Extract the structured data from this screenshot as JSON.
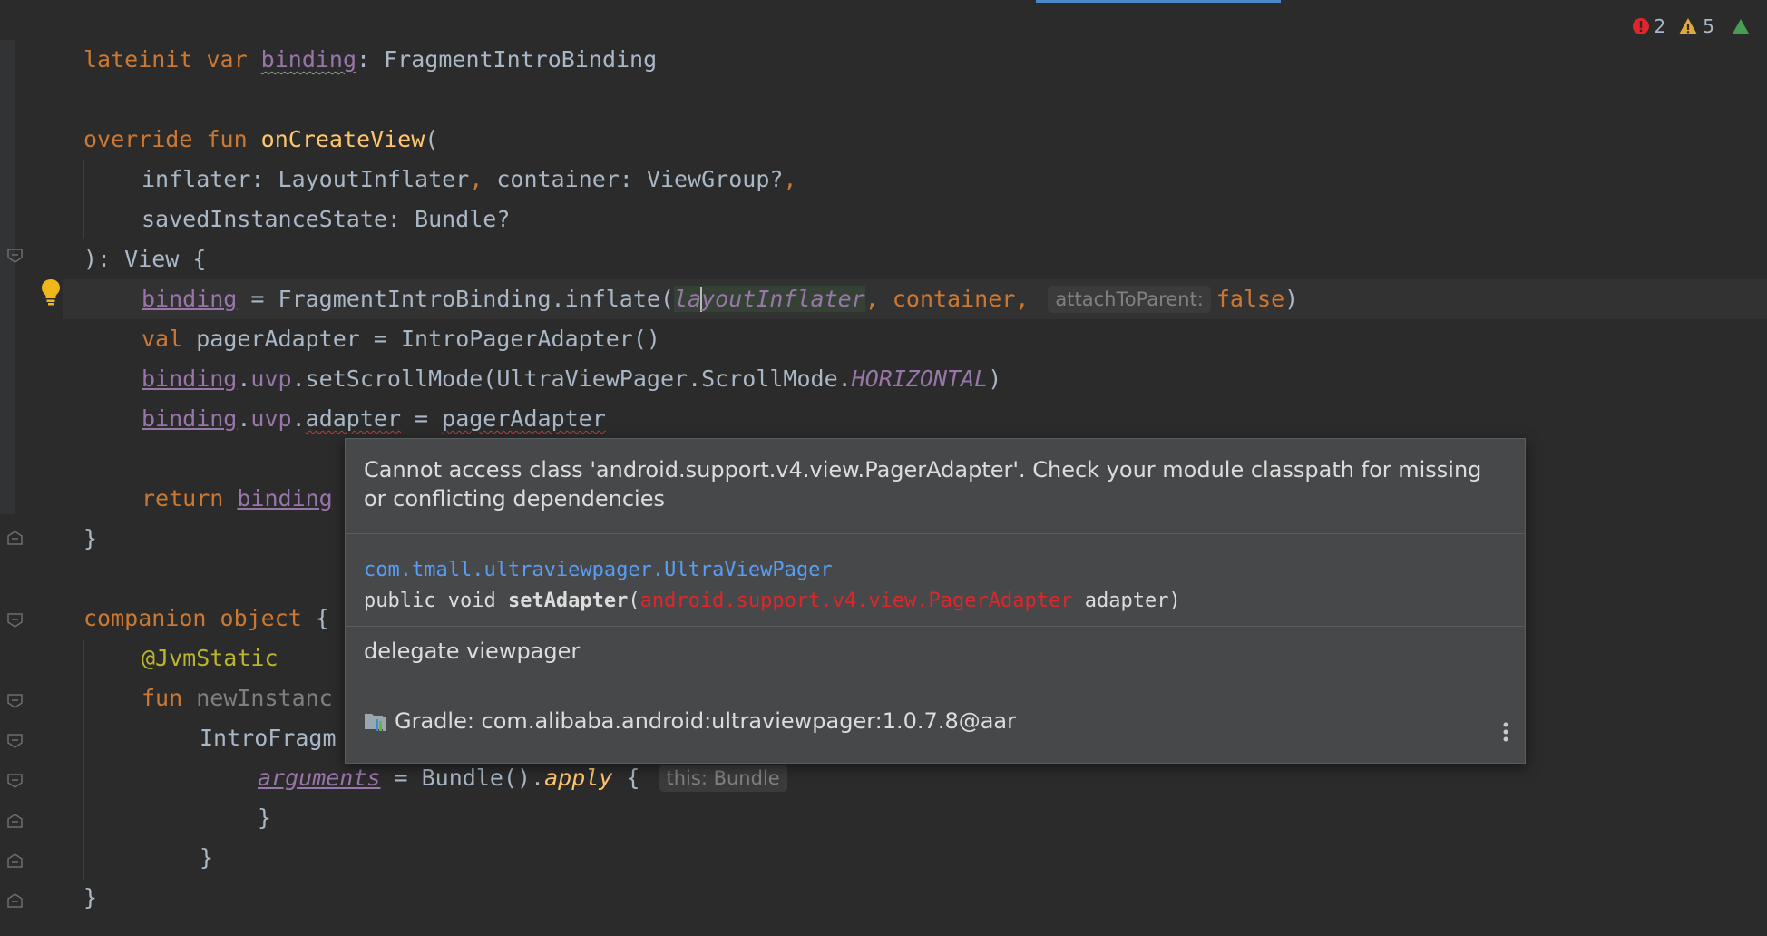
{
  "status": {
    "errors_count": "2",
    "warnings_count": "5"
  },
  "code": {
    "l1_kw": "lateinit var ",
    "l1_binding": "binding",
    "l1_rest": ": FragmentIntroBinding",
    "l2_override": "override fun ",
    "l2_fn": "onCreateView",
    "l2_paren": "(",
    "l3_a": "inflater: LayoutInflater",
    "l3_comma": ", ",
    "l3_b": "container: ViewGroup?",
    "l3_comma2": ",",
    "l4": "savedInstanceState: Bundle?",
    "l5": "): View {",
    "l6_binding": "binding",
    "l6_a": " = FragmentIntroBinding.inflate(",
    "l6_li_a": "la",
    "l6_li_b": "youtInflater",
    "l6_b": ", container, ",
    "l6_hint": "attachToParent:",
    "l6_false": "false",
    "l6_close": ")",
    "l7_val": "val ",
    "l7_rest": "pagerAdapter = IntroPagerAdapter()",
    "l8_binding": "binding",
    "l8_dot": ".",
    "l8_uvp": "uvp",
    "l8_rest": ".setScrollMode(UltraViewPager.ScrollMode.",
    "l8_const": "HORIZONTAL",
    "l8_close": ")",
    "l9_binding": "binding",
    "l9_dot": ".",
    "l9_uvp": "uvp",
    "l9_dot2": ".",
    "l9_adapter": "adapter",
    "l9_eq": " = ",
    "l9_pager": "pagerAdapter",
    "l10_return": "return ",
    "l10_binding": "binding",
    "l11": "}",
    "l12_kw": "companion object ",
    "l12_brace": "{",
    "l13": "@JvmStatic",
    "l14_kw": "fun ",
    "l14_rest": "newInstanc",
    "l15": "IntroFragm",
    "l16_args": "arguments",
    "l16_a": " = Bundle().",
    "l16_apply": "apply",
    "l16_b": " { ",
    "l16_hint": "this: Bundle",
    "l17": "}",
    "l18": "}",
    "l19": "}"
  },
  "popup": {
    "message": "Cannot access class 'android.support.v4.view.PagerAdapter'. Check your module classpath for missing or conflicting dependencies",
    "class_fqn": "com.tmall.ultraviewpager.UltraViewPager",
    "sig_prefix": "public void ",
    "sig_method": "setAdapter",
    "sig_open": "(",
    "sig_type": "android.support.v4.view.PagerAdapter",
    "sig_rest": " adapter)",
    "description": "delegate viewpager",
    "library": "Gradle: com.alibaba.android:ultraviewpager:1.0.7.8@aar"
  },
  "colors": {
    "background": "#2b2b2b",
    "keyword": "#cc7832",
    "function": "#ffc66d",
    "property": "#9876aa",
    "annotation": "#bbb529",
    "error": "#e0262a",
    "link": "#589df6"
  }
}
